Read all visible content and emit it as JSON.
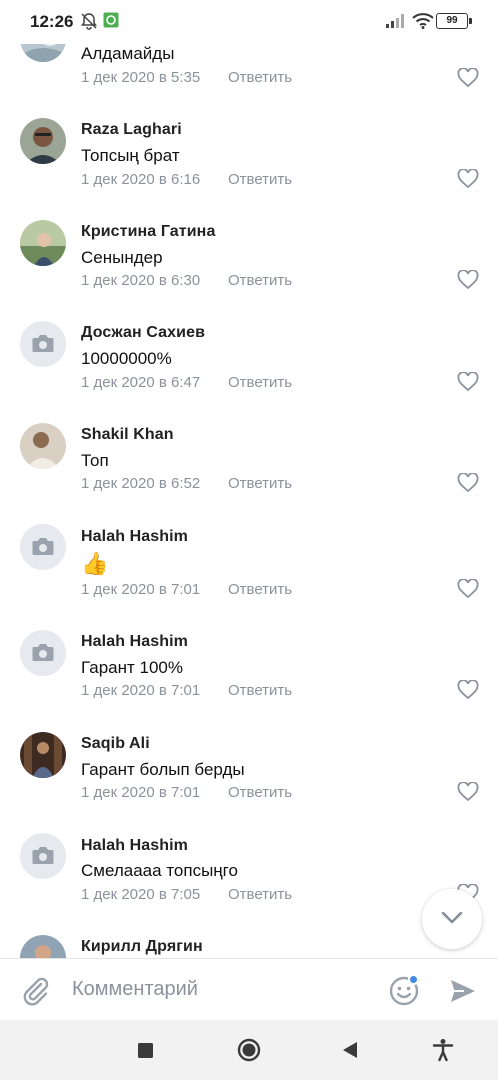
{
  "status_bar": {
    "time": "12:26",
    "battery": "99"
  },
  "comments": [
    {
      "author": "",
      "text": "Алдамайды",
      "date": "1 дек 2020 в 5:35",
      "reply_label": "Ответить",
      "avatar": "photo"
    },
    {
      "author": "Raza Laghari",
      "text": "Топсың брат",
      "date": "1 дек 2020 в 6:16",
      "reply_label": "Ответить",
      "avatar": "photo"
    },
    {
      "author": "Кристина Гатина",
      "text": "Сенындер",
      "date": "1 дек 2020 в 6:30",
      "reply_label": "Ответить",
      "avatar": "photo"
    },
    {
      "author": "Досжан Сахиев",
      "text": "10000000%",
      "date": "1 дек 2020 в 6:47",
      "reply_label": "Ответить",
      "avatar": "camera-placeholder"
    },
    {
      "author": "Shakil Khan",
      "text": "Топ",
      "date": "1 дек 2020 в 6:52",
      "reply_label": "Ответить",
      "avatar": "photo"
    },
    {
      "author": "Halah Hashim",
      "text": "👍",
      "date": "1 дек 2020 в 7:01",
      "reply_label": "Ответить",
      "avatar": "camera-placeholder"
    },
    {
      "author": "Halah Hashim",
      "text": "Гарант 100%",
      "date": "1 дек 2020 в 7:01",
      "reply_label": "Ответить",
      "avatar": "camera-placeholder"
    },
    {
      "author": "Saqib Ali",
      "text": "Гарант болып берды",
      "date": "1 дек 2020 в 7:01",
      "reply_label": "Ответить",
      "avatar": "photo"
    },
    {
      "author": "Halah Hashim",
      "text": "Смелаааа топсыңго",
      "date": "1 дек 2020 в 7:05",
      "reply_label": "Ответить",
      "avatar": "camera-placeholder"
    },
    {
      "author": "Кирилл Дрягин",
      "text": "",
      "date": "",
      "reply_label": "",
      "avatar": "photo"
    }
  ],
  "composer": {
    "placeholder": "Комментарий"
  },
  "icons": {
    "status": [
      "mute-bell-icon",
      "app-notification-icon",
      "signal-icon",
      "wifi-icon",
      "battery-icon"
    ],
    "composer": [
      "attach-paperclip-icon",
      "emoji-icon",
      "send-icon"
    ],
    "nav": [
      "recent-apps-icon",
      "home-icon",
      "back-icon",
      "accessibility-icon"
    ],
    "like": "heart-icon",
    "scroll": "chevron-down-icon"
  },
  "colors": {
    "secondary_text": "#8c929b",
    "placeholder_avatar": "#e6e9ee",
    "accent_icon": "#99a2ad",
    "badge": "#3f8ae0"
  }
}
